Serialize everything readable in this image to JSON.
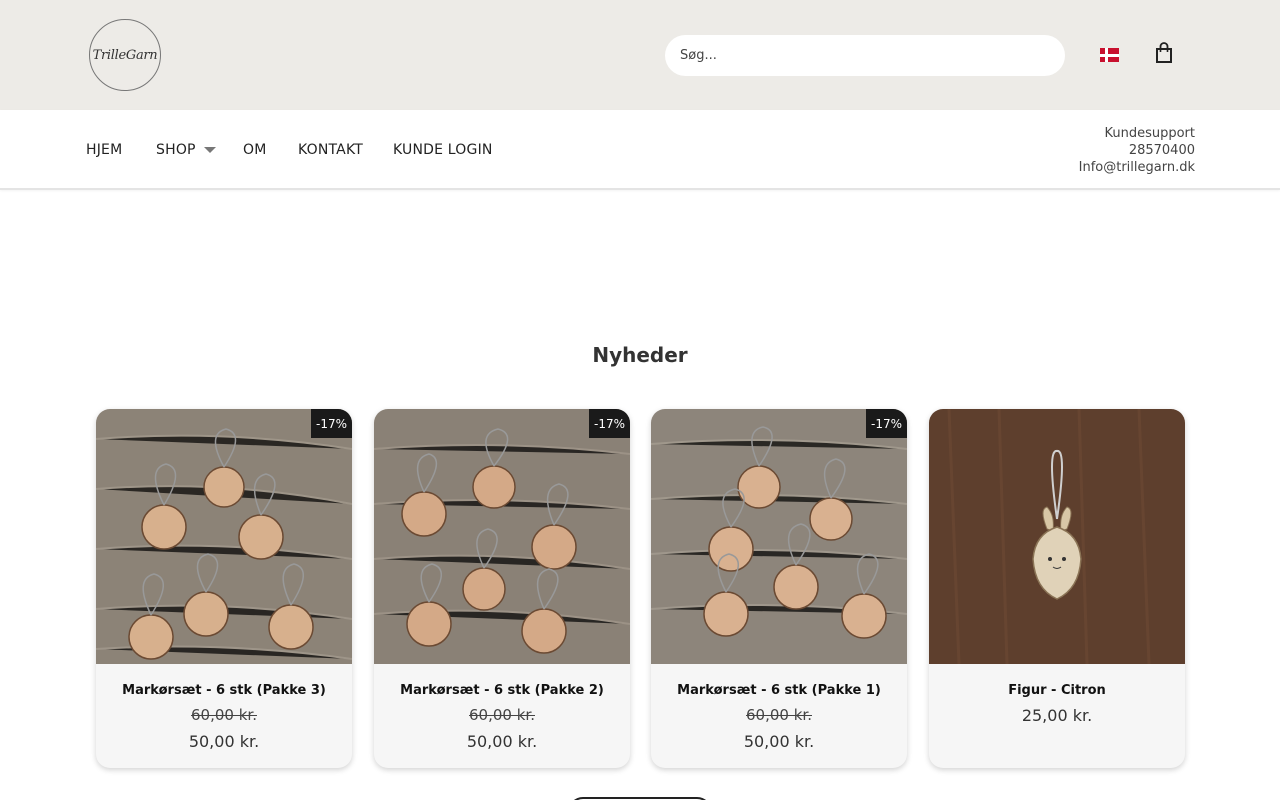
{
  "header": {
    "logo_text": "TrilleGarn",
    "search_placeholder": "Søg...",
    "flag_icon": "denmark-flag-icon",
    "cart_icon": "shopping-bag-icon"
  },
  "nav": {
    "items": [
      {
        "label": "HJEM"
      },
      {
        "label": "SHOP"
      },
      {
        "label": "OM"
      },
      {
        "label": "KONTAKT"
      },
      {
        "label": "KUNDE LOGIN"
      }
    ],
    "dropdown_icon": "caret-down-icon"
  },
  "support": {
    "label": "Kundesupport",
    "phone": "28570400",
    "email": "Info@trillegarn.dk"
  },
  "section": {
    "title": "Nyheder"
  },
  "products": [
    {
      "name": "Markørsæt - 6 stk (Pakke 3)",
      "badge": "-17%",
      "old_price": "60,00 kr.",
      "price": "50,00 kr."
    },
    {
      "name": "Markørsæt - 6 stk (Pakke 2)",
      "badge": "-17%",
      "old_price": "60,00 kr.",
      "price": "50,00 kr."
    },
    {
      "name": "Markørsæt - 6 stk (Pakke 1)",
      "badge": "-17%",
      "old_price": "60,00 kr.",
      "price": "50,00 kr."
    },
    {
      "name": "Figur - Citron",
      "badge": "",
      "old_price": "",
      "price": "25,00 kr."
    }
  ],
  "colors": {
    "header_bg": "#edebe7",
    "badge_bg": "#1a1a1a",
    "card_bg": "#f6f6f6"
  }
}
